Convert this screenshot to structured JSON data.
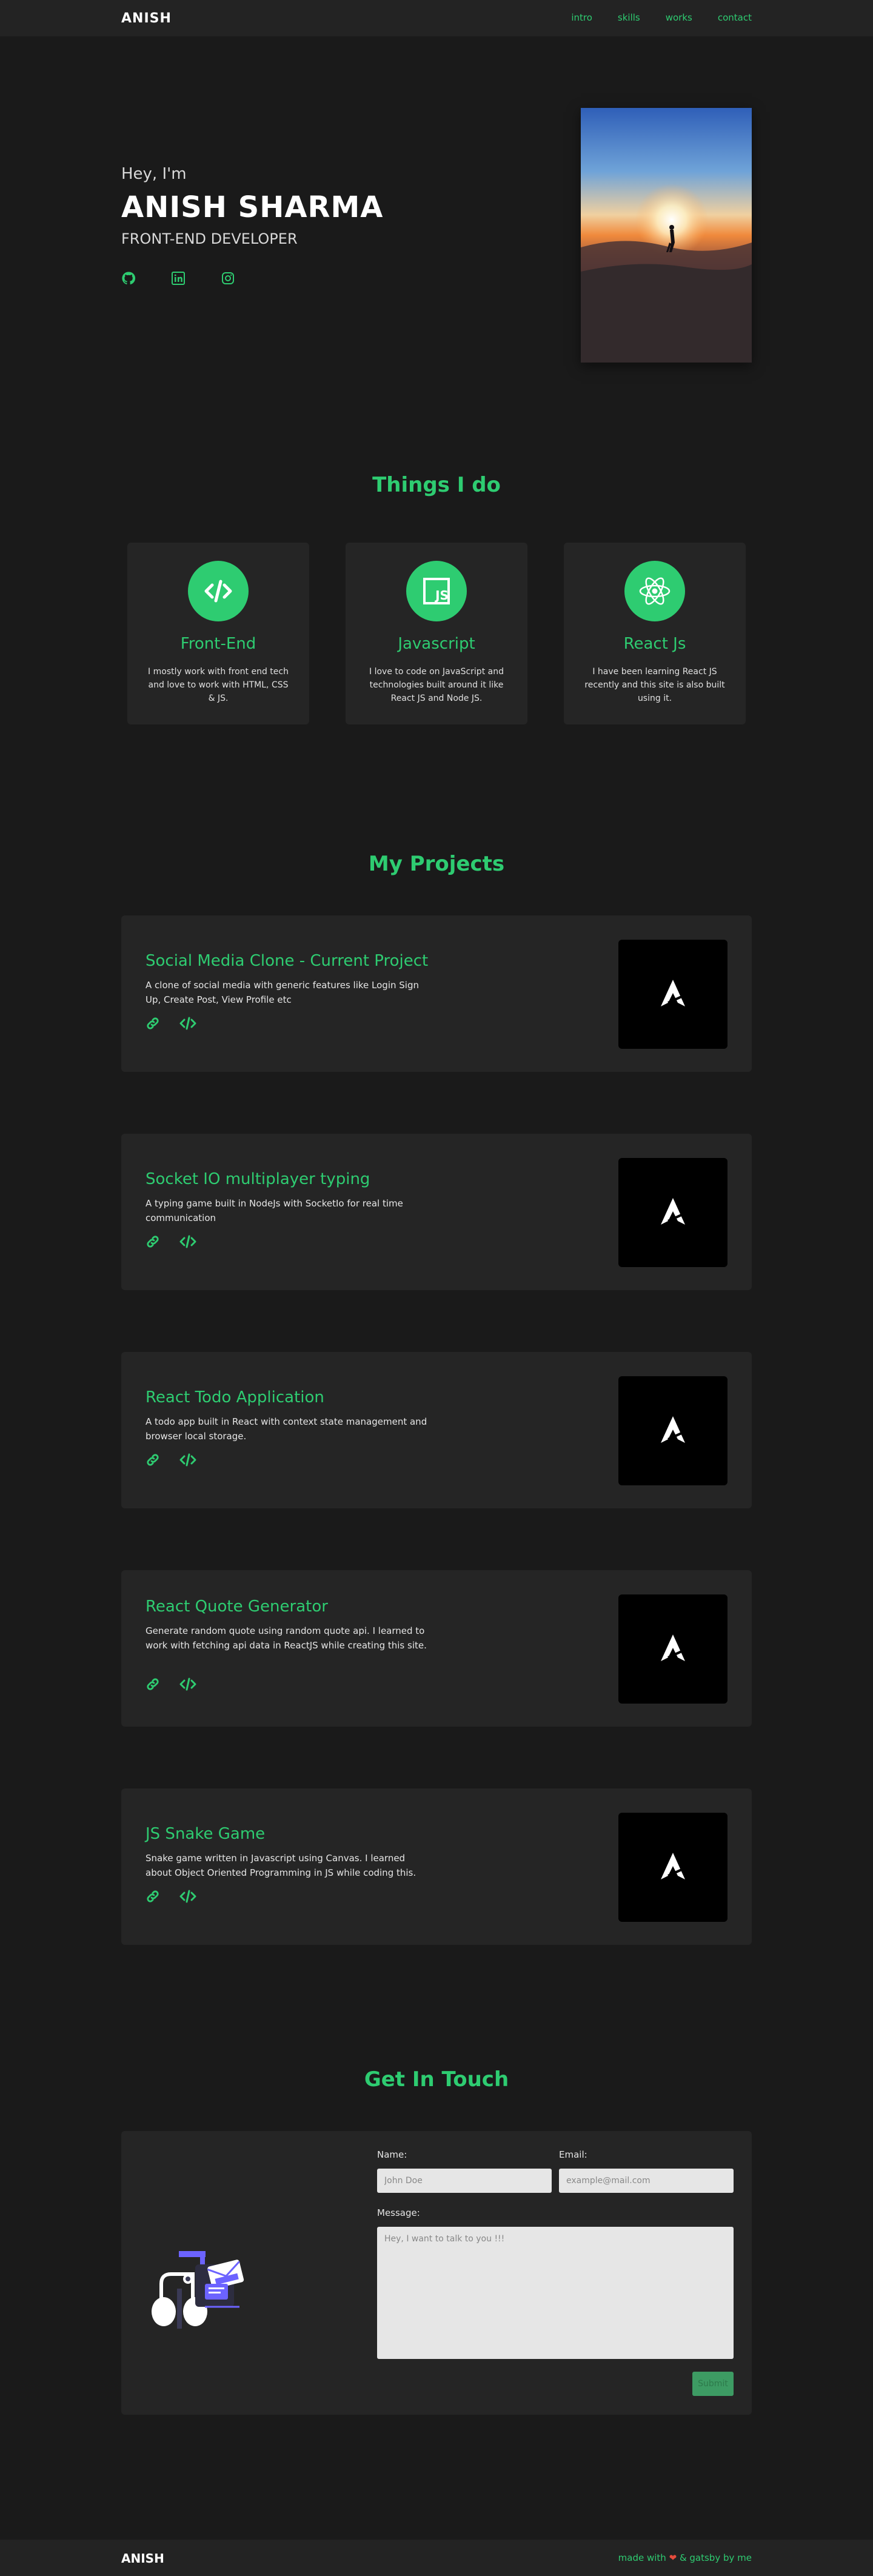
{
  "nav": {
    "logo": "ANISH",
    "links": [
      "intro",
      "skills",
      "works",
      "contact"
    ]
  },
  "hero": {
    "greeting": "Hey, I'm",
    "name": "ANISH SHARMA",
    "role": "FRONT-END DEVELOPER",
    "social_icons": [
      "github-icon",
      "linkedin-icon",
      "instagram-icon"
    ]
  },
  "skills": {
    "title": "Things I do",
    "items": [
      {
        "title": "Front-End",
        "desc": "I mostly work with front end tech and love to work with HTML, CSS & JS.",
        "icon": "code-icon"
      },
      {
        "title": "Javascript",
        "desc": "I love to code on JavaScript and technologies built around it like React JS and Node JS.",
        "icon": "js-icon"
      },
      {
        "title": "React Js",
        "desc": "I have been learning React JS recently and this site is also built using it.",
        "icon": "react-icon"
      }
    ]
  },
  "projects": {
    "title": "My Projects",
    "items": [
      {
        "title": "Social Media Clone - Current Project",
        "desc": "A clone of social media with generic features like Login Sign Up, Create Post, View Profile etc"
      },
      {
        "title": "Socket IO multiplayer typing",
        "desc": "A typing game built in NodeJs with SocketIo for real time communication"
      },
      {
        "title": "React Todo Application",
        "desc": "A todo app built in React with context state management and browser local storage."
      },
      {
        "title": "React Quote Generator",
        "desc": "Generate random quote using random quote api. I learned to work with fetching api data in ReactJS while creating this site."
      },
      {
        "title": "JS Snake Game",
        "desc": "Snake game written in Javascript using Canvas. I learned about Object Oriented Programming in JS while coding this."
      }
    ]
  },
  "contact": {
    "title": "Get In Touch",
    "name_label": "Name:",
    "name_placeholder": "John Doe",
    "email_label": "Email:",
    "email_placeholder": "example@mail.com",
    "message_label": "Message:",
    "message_placeholder": "Hey, I want to talk to you !!!",
    "submit_label": "Submit"
  },
  "footer": {
    "logo": "ANISH",
    "made_prefix": "made with",
    "made_suffix": "& gatsby by me"
  },
  "colors": {
    "accent": "#2ecc71",
    "background": "#1a1a1a",
    "card": "#252525"
  }
}
